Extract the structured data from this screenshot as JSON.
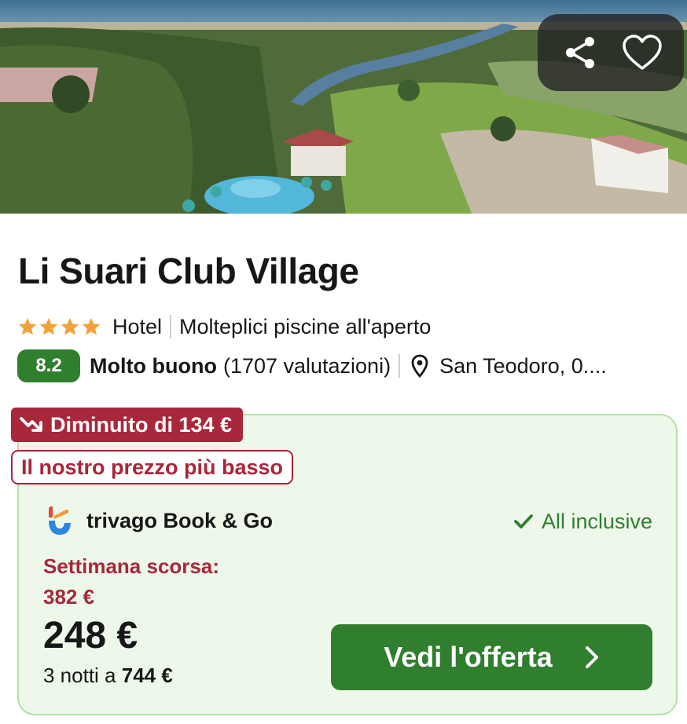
{
  "hero": {
    "image_alt": "Aerial view of resort with pools, lawns and river",
    "share_icon": "share-icon",
    "favorite_icon": "heart-icon"
  },
  "hotel": {
    "name": "Li Suari Club Village",
    "stars": 4,
    "type": "Hotel",
    "feature": "Molteplici piscine all'aperto",
    "score": "8.2",
    "rating_label": "Molto buono",
    "reviews": "(1707 valutazioni)",
    "location": "San Teodoro, 0...."
  },
  "offer": {
    "price_drop": "Diminuito di 134 €",
    "lowest_badge": "Il nostro prezzo più basso",
    "provider": "trivago Book & Go",
    "board": "All inclusive",
    "last_week_label": "Settimana scorsa:",
    "old_price": "382 €",
    "price": "248 €",
    "nights_prefix": "3 notti a",
    "total": "744 €",
    "cta": "Vedi l'offerta"
  },
  "colors": {
    "accent_green": "#2f7f2f",
    "card_bg": "#edf8ea",
    "alert_red": "#a8273a",
    "star_orange": "#f2a23a"
  }
}
